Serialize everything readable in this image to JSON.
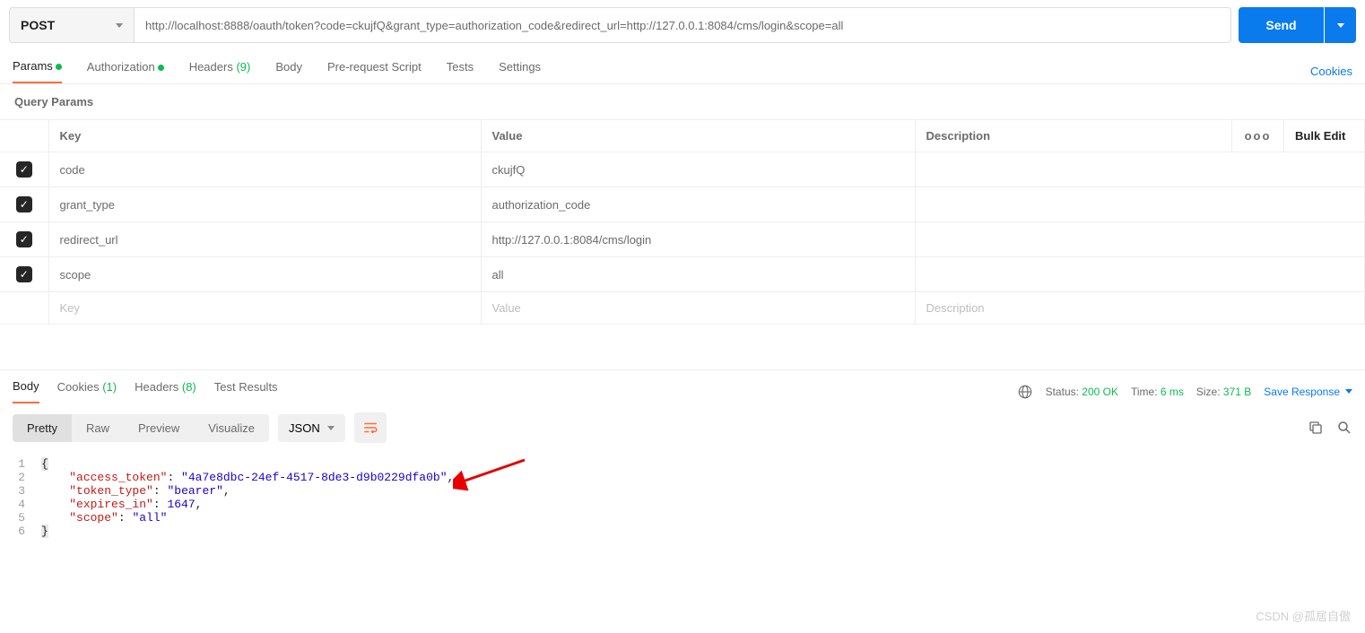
{
  "request": {
    "method": "POST",
    "url": "http://localhost:8888/oauth/token?code=ckujfQ&grant_type=authorization_code&redirect_url=http://127.0.0.1:8084/cms/login&scope=all",
    "send_label": "Send"
  },
  "tabs": {
    "params": "Params",
    "auth": "Authorization",
    "headers": "Headers ",
    "headers_count": "(9)",
    "body": "Body",
    "prereq": "Pre-request Script",
    "tests": "Tests",
    "settings": "Settings",
    "cookies": "Cookies"
  },
  "query": {
    "title": "Query Params",
    "headers": {
      "key": "Key",
      "value": "Value",
      "desc": "Description",
      "bulk": "Bulk Edit"
    },
    "rows": [
      {
        "key": "code",
        "value": "ckujfQ"
      },
      {
        "key": "grant_type",
        "value": "authorization_code"
      },
      {
        "key": "redirect_url",
        "value": "http://127.0.0.1:8084/cms/login"
      },
      {
        "key": "scope",
        "value": "all"
      }
    ],
    "placeholders": {
      "key": "Key",
      "value": "Value",
      "desc": "Description"
    },
    "more": "ooo"
  },
  "response": {
    "tabs": {
      "body": "Body",
      "cookies": "Cookies ",
      "cookies_count": "(1)",
      "headers": "Headers ",
      "headers_count": "(8)",
      "tests": "Test Results"
    },
    "status_label": "Status: ",
    "status_value": "200 OK",
    "time_label": "Time: ",
    "time_value": "6 ms",
    "size_label": "Size: ",
    "size_value": "371 B",
    "save": "Save Response"
  },
  "view": {
    "pretty": "Pretty",
    "raw": "Raw",
    "preview": "Preview",
    "visualize": "Visualize",
    "format": "JSON"
  },
  "body_json": {
    "access_token": "4a7e8dbc-24ef-4517-8de3-d9b0229dfa0b",
    "token_type": "bearer",
    "expires_in": 1647,
    "scope": "all"
  },
  "watermark": "CSDN @孤居自傲"
}
